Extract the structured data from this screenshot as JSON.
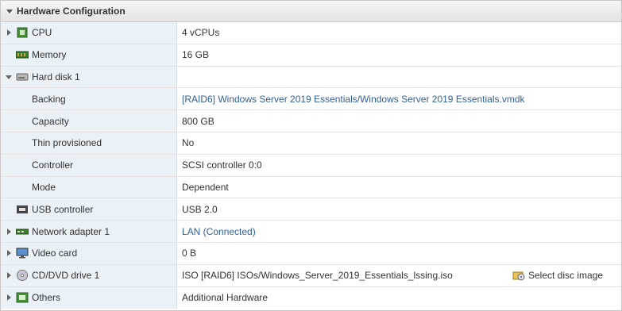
{
  "header": {
    "title": "Hardware Configuration"
  },
  "rows": {
    "cpu": {
      "label": "CPU",
      "value": "4 vCPUs",
      "icon": "cpu-icon"
    },
    "memory": {
      "label": "Memory",
      "value": "16 GB",
      "icon": "memory-icon"
    },
    "hard_disk": {
      "label": "Hard disk 1",
      "value": "",
      "icon": "hard-disk-icon"
    },
    "backing": {
      "label": "Backing",
      "value": "[RAID6] Windows Server 2019 Essentials/Windows Server 2019 Essentials.vmdk"
    },
    "capacity": {
      "label": "Capacity",
      "value": "800 GB"
    },
    "thin": {
      "label": "Thin provisioned",
      "value": "No"
    },
    "controller": {
      "label": "Controller",
      "value": "SCSI controller 0:0"
    },
    "mode": {
      "label": "Mode",
      "value": "Dependent"
    },
    "usb": {
      "label": "USB controller",
      "value": "USB 2.0",
      "icon": "usb-icon"
    },
    "network": {
      "label": "Network adapter 1",
      "value": "LAN (Connected)",
      "icon": "network-adapter-icon"
    },
    "video": {
      "label": "Video card",
      "value": "0 B",
      "icon": "monitor-icon"
    },
    "cd": {
      "label": "CD/DVD drive 1",
      "value": "ISO [RAID6] ISOs/Windows_Server_2019_Essentials_lssing.iso",
      "icon": "cd-icon",
      "action": "Select disc image"
    },
    "others": {
      "label": "Others",
      "value": "Additional Hardware",
      "icon": "others-icon"
    }
  },
  "colors": {
    "label_bg": "#eaf1f7",
    "link": "#2f5f9e"
  }
}
